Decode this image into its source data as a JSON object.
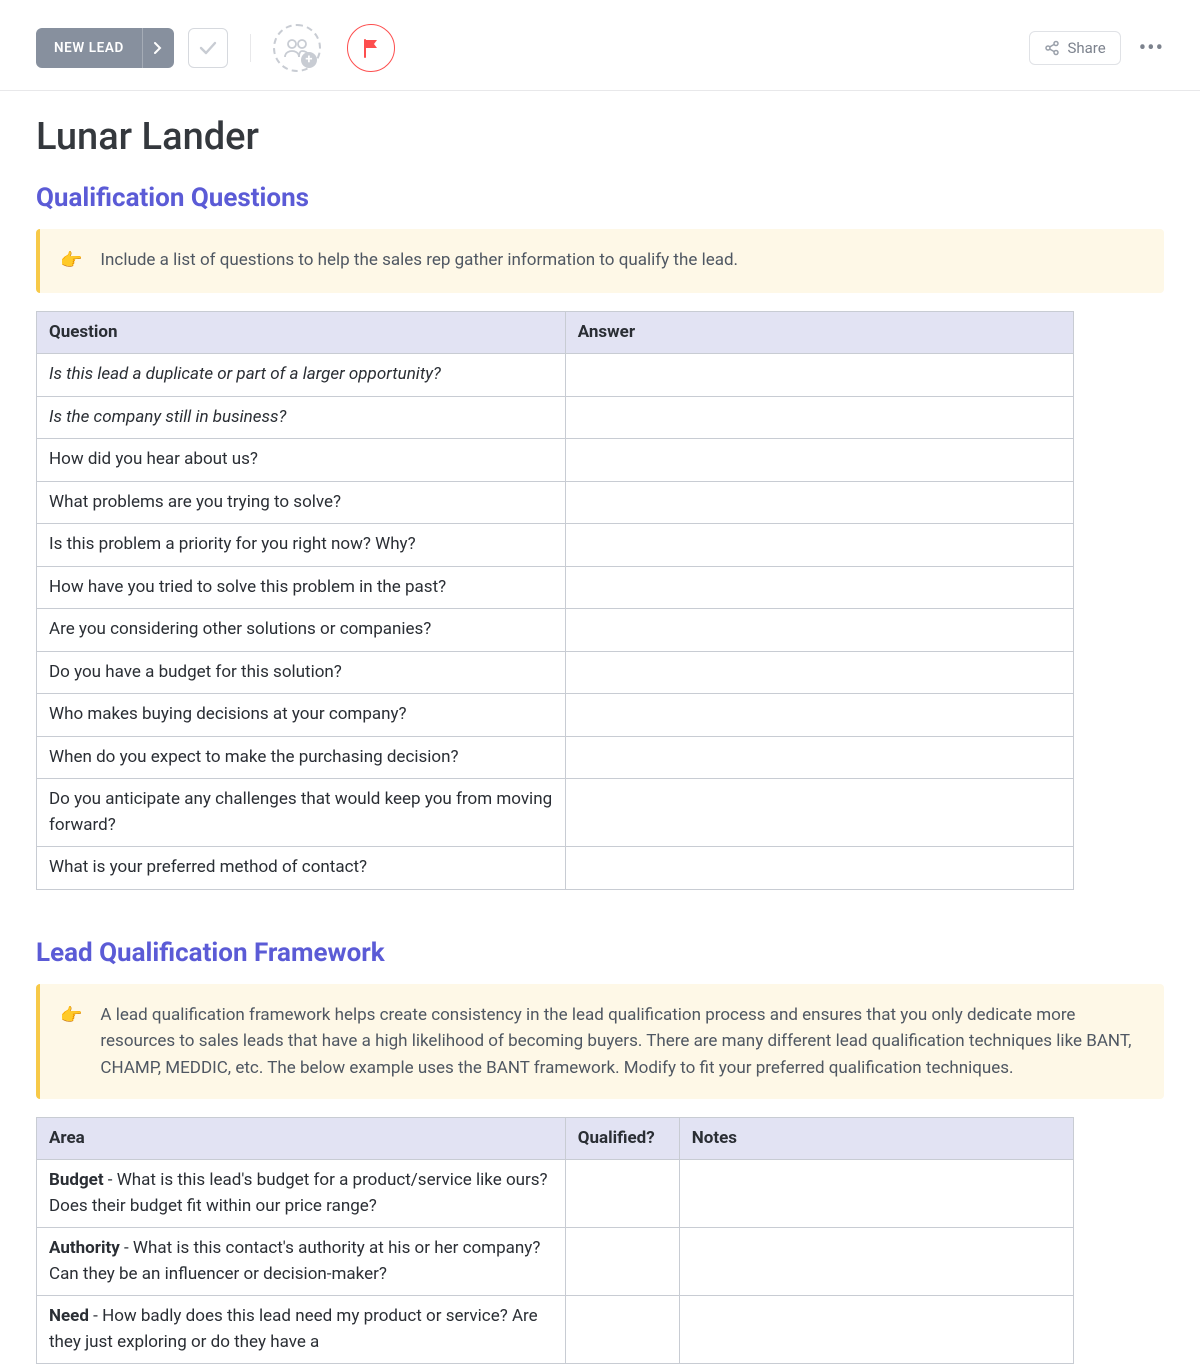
{
  "toolbar": {
    "status_label": "NEW LEAD",
    "share_label": "Share"
  },
  "page": {
    "title": "Lunar Lander"
  },
  "section1": {
    "title": "Qualification Questions",
    "callout_emoji": "👉",
    "callout_text": "Include a list of questions to help the sales rep gather information to qualify the lead.",
    "headers": {
      "q": "Question",
      "a": "Answer"
    },
    "rows": [
      {
        "q": "Is this lead a duplicate or part of a larger opportunity?",
        "italic": true,
        "a": ""
      },
      {
        "q": "Is the company still in business?",
        "italic": true,
        "a": ""
      },
      {
        "q": "How did you hear about us?",
        "italic": false,
        "a": ""
      },
      {
        "q": "What problems are you trying to solve?",
        "italic": false,
        "a": ""
      },
      {
        "q": "Is this problem a priority for you right now? Why?",
        "italic": false,
        "a": ""
      },
      {
        "q": "How have you tried to solve this problem in the past?",
        "italic": false,
        "a": ""
      },
      {
        "q": "Are you considering other solutions or companies?",
        "italic": false,
        "a": ""
      },
      {
        "q": "Do you have a budget for this solution?",
        "italic": false,
        "a": ""
      },
      {
        "q": "Who makes buying decisions at your company?",
        "italic": false,
        "a": ""
      },
      {
        "q": "When do you expect to make the purchasing decision?",
        "italic": false,
        "a": ""
      },
      {
        "q": "Do you anticipate any challenges that would keep you from moving forward?",
        "italic": false,
        "a": ""
      },
      {
        "q": "What is your preferred method of contact?",
        "italic": false,
        "a": ""
      }
    ]
  },
  "section2": {
    "title": "Lead Qualification Framework",
    "callout_emoji": "👉",
    "callout_text": "A lead qualification framework helps create consistency in the lead qualification process and ensures that you only dedicate more resources to sales leads that have a high likelihood of becoming buyers. There are many different lead qualification techniques like BANT, CHAMP, MEDDIC, etc. The below example uses the BANT framework. Modify to fit your preferred qualification techniques.",
    "headers": {
      "area": "Area",
      "qualified": "Qualified?",
      "notes": "Notes"
    },
    "rows": [
      {
        "term": "Budget",
        "desc": " - What is this lead's budget for a product/service like ours? Does their budget fit within our price range?",
        "qualified": "",
        "notes": ""
      },
      {
        "term": "Authority",
        "desc": " - What is this contact's authority at his or her company? Can they be an influencer or decision-maker?",
        "qualified": "",
        "notes": ""
      },
      {
        "term": "Need",
        "desc": " - How badly does this lead need my product or service? Are they just exploring or do they have a",
        "qualified": "",
        "notes": ""
      }
    ]
  }
}
